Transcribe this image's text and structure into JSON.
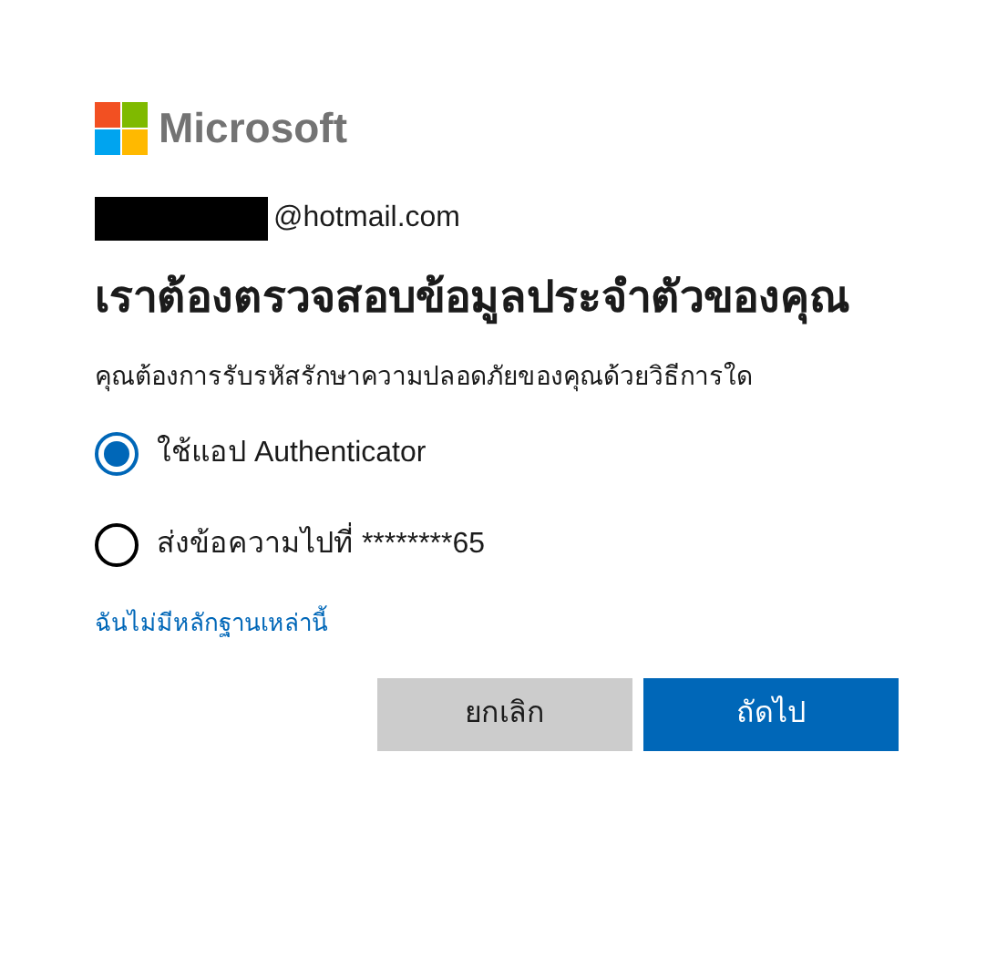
{
  "brand": {
    "name": "Microsoft"
  },
  "account": {
    "email_suffix": "@hotmail.com"
  },
  "title": "เราต้องตรวจสอบข้อมูลประจำตัวของคุณ",
  "subtitle": "คุณต้องการรับรหัสรักษาความปลอดภัยของคุณด้วยวิธีการใด",
  "options": [
    {
      "label": "ใช้แอป Authenticator",
      "selected": true
    },
    {
      "label": "ส่งข้อความไปที่ ********65",
      "selected": false
    }
  ],
  "link": "ฉันไม่มีหลักฐานเหล่านี้",
  "buttons": [
    {
      "label": "ยกเลิก",
      "kind": "secondary"
    },
    {
      "label": "ถัดไป",
      "kind": "primary"
    }
  ]
}
